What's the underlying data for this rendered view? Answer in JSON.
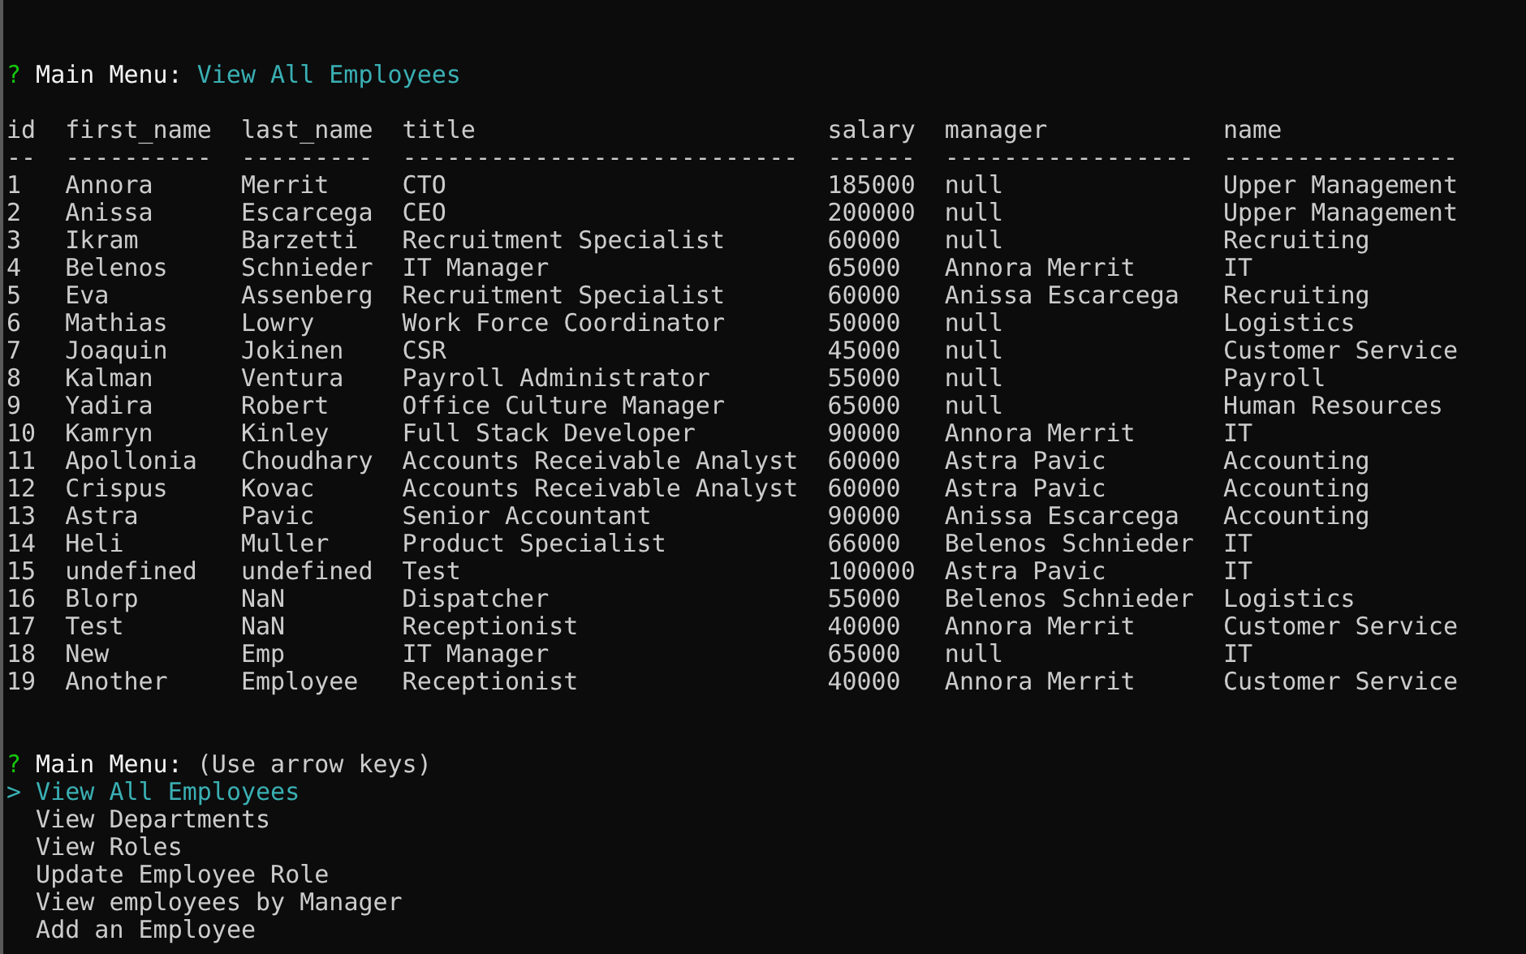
{
  "first_prompt": {
    "mark": "?",
    "label": "Main Menu:",
    "answer": "View All Employees"
  },
  "table": {
    "columns": [
      {
        "header": "id",
        "rule": "--"
      },
      {
        "header": "first_name",
        "rule": "----------"
      },
      {
        "header": "last_name",
        "rule": "---------"
      },
      {
        "header": "title",
        "rule": "---------------------------"
      },
      {
        "header": "salary",
        "rule": "------"
      },
      {
        "header": "manager",
        "rule": "-----------------"
      },
      {
        "header": "name",
        "rule": "----------------"
      }
    ],
    "rows": [
      [
        "1",
        "Annora",
        "Merrit",
        "CTO",
        "185000",
        "null",
        "Upper Management"
      ],
      [
        "2",
        "Anissa",
        "Escarcega",
        "CEO",
        "200000",
        "null",
        "Upper Management"
      ],
      [
        "3",
        "Ikram",
        "Barzetti",
        "Recruitment Specialist",
        "60000",
        "null",
        "Recruiting"
      ],
      [
        "4",
        "Belenos",
        "Schnieder",
        "IT Manager",
        "65000",
        "Annora Merrit",
        "IT"
      ],
      [
        "5",
        "Eva",
        "Assenberg",
        "Recruitment Specialist",
        "60000",
        "Anissa Escarcega",
        "Recruiting"
      ],
      [
        "6",
        "Mathias",
        "Lowry",
        "Work Force Coordinator",
        "50000",
        "null",
        "Logistics"
      ],
      [
        "7",
        "Joaquin",
        "Jokinen",
        "CSR",
        "45000",
        "null",
        "Customer Service"
      ],
      [
        "8",
        "Kalman",
        "Ventura",
        "Payroll Administrator",
        "55000",
        "null",
        "Payroll"
      ],
      [
        "9",
        "Yadira",
        "Robert",
        "Office Culture Manager",
        "65000",
        "null",
        "Human Resources"
      ],
      [
        "10",
        "Kamryn",
        "Kinley",
        "Full Stack Developer",
        "90000",
        "Annora Merrit",
        "IT"
      ],
      [
        "11",
        "Apollonia",
        "Choudhary",
        "Accounts Receivable Analyst",
        "60000",
        "Astra Pavic",
        "Accounting"
      ],
      [
        "12",
        "Crispus",
        "Kovac",
        "Accounts Receivable Analyst",
        "60000",
        "Astra Pavic",
        "Accounting"
      ],
      [
        "13",
        "Astra",
        "Pavic",
        "Senior Accountant",
        "90000",
        "Anissa Escarcega",
        "Accounting"
      ],
      [
        "14",
        "Heli",
        "Muller",
        "Product Specialist",
        "66000",
        "Belenos Schnieder",
        "IT"
      ],
      [
        "15",
        "undefined",
        "undefined",
        "Test",
        "100000",
        "Astra Pavic",
        "IT"
      ],
      [
        "16",
        "Blorp",
        "NaN",
        "Dispatcher",
        "55000",
        "Belenos Schnieder",
        "Logistics"
      ],
      [
        "17",
        "Test",
        "NaN",
        "Receptionist",
        "40000",
        "Annora Merrit",
        "Customer Service"
      ],
      [
        "18",
        "New",
        "Emp",
        "IT Manager",
        "65000",
        "null",
        "IT"
      ],
      [
        "19",
        "Another",
        "Employee",
        "Receptionist",
        "40000",
        "Annora Merrit",
        "Customer Service"
      ]
    ]
  },
  "second_prompt": {
    "mark": "?",
    "label": "Main Menu:",
    "hint": "(Use arrow keys)",
    "pointer": ">",
    "items": [
      {
        "label": "View All Employees",
        "selected": true
      },
      {
        "label": "View Departments",
        "selected": false
      },
      {
        "label": "View Roles",
        "selected": false
      },
      {
        "label": "Update Employee Role",
        "selected": false
      },
      {
        "label": "View employees by Manager",
        "selected": false
      },
      {
        "label": "Add an Employee",
        "selected": false
      }
    ]
  }
}
